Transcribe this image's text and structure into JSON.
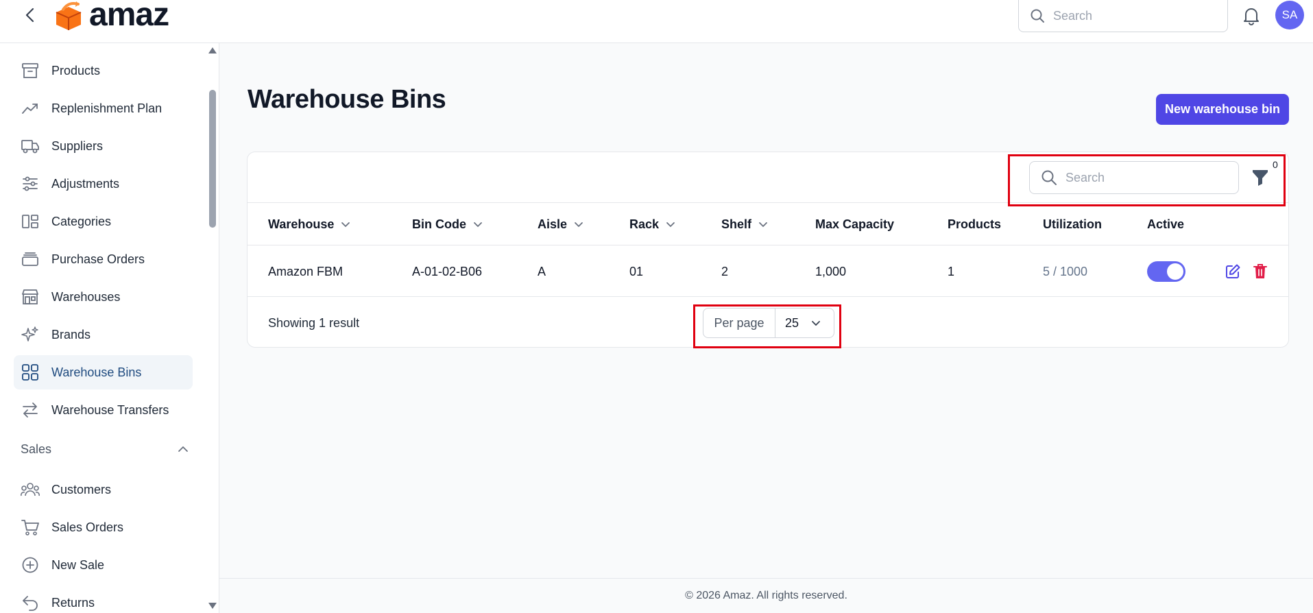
{
  "app": {
    "logo_text": "amaz",
    "top_search_placeholder": "Search",
    "avatar_initials": "SA"
  },
  "sidebar": {
    "items": [
      {
        "label": "Products",
        "icon": "archive-box-icon"
      },
      {
        "label": "Replenishment Plan",
        "icon": "trending-up-icon"
      },
      {
        "label": "Suppliers",
        "icon": "truck-icon"
      },
      {
        "label": "Adjustments",
        "icon": "sliders-icon"
      },
      {
        "label": "Categories",
        "icon": "categories-icon"
      },
      {
        "label": "Purchase Orders",
        "icon": "stack-icon"
      },
      {
        "label": "Warehouses",
        "icon": "building-storefront-icon"
      },
      {
        "label": "Brands",
        "icon": "sparkles-icon"
      },
      {
        "label": "Warehouse Bins",
        "icon": "grid-icon",
        "active": true
      },
      {
        "label": "Warehouse Transfers",
        "icon": "arrows-right-left-icon"
      }
    ],
    "sales_section": {
      "label": "Sales",
      "items": [
        {
          "label": "Customers",
          "icon": "users-icon"
        },
        {
          "label": "Sales Orders",
          "icon": "shopping-cart-icon"
        },
        {
          "label": "New Sale",
          "icon": "plus-circle-icon"
        },
        {
          "label": "Returns",
          "icon": "arrow-uturn-left-icon"
        }
      ]
    }
  },
  "main": {
    "title": "Warehouse Bins",
    "new_button_label": "New warehouse bin",
    "table": {
      "search_placeholder": "Search",
      "filter_count": "0",
      "columns": [
        "Warehouse",
        "Bin Code",
        "Aisle",
        "Rack",
        "Shelf",
        "Max Capacity",
        "Products",
        "Utilization",
        "Active"
      ],
      "rows": [
        {
          "warehouse": "Amazon FBM",
          "bin_code": "A-01-02-B06",
          "aisle": "A",
          "rack": "01",
          "shelf": "2",
          "max_capacity": "1,000",
          "products": "1",
          "utilization": "5 / 1000",
          "active": true
        }
      ],
      "showing_text": "Showing 1 result",
      "per_page_label": "Per page",
      "per_page_value": "25"
    }
  },
  "footer": {
    "text": "© 2026 Amaz. All rights reserved."
  },
  "colors": {
    "accent": "#4f46e5",
    "toggle_on": "#6366f1",
    "delete": "#e11d48",
    "highlight": "#e00010"
  }
}
